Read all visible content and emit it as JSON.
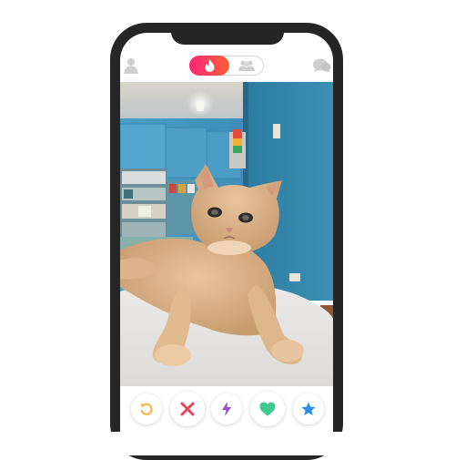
{
  "header": {
    "profile_icon": "person-icon",
    "mode_active_icon": "flame-icon",
    "mode_inactive_icon": "group-icon",
    "messages_icon": "chat-bubbles-icon"
  },
  "card": {
    "photo_subject": "cat-photo"
  },
  "actions": [
    {
      "name": "rewind-button",
      "icon": "rewind-icon",
      "color": "#f5b748"
    },
    {
      "name": "nope-button",
      "icon": "close-icon",
      "color": "#e8445a"
    },
    {
      "name": "boost-button",
      "icon": "lightning-icon",
      "color": "#9b4ad6"
    },
    {
      "name": "like-button",
      "icon": "heart-icon",
      "color": "#3ec98e"
    },
    {
      "name": "super-like-button",
      "icon": "star-icon",
      "color": "#2b8fe8"
    }
  ],
  "colors": {
    "brand_gradient_start": "#fd267a",
    "brand_gradient_end": "#ff6036",
    "phone_frame": "#252525",
    "inactive_icon": "#cfcfcf"
  }
}
